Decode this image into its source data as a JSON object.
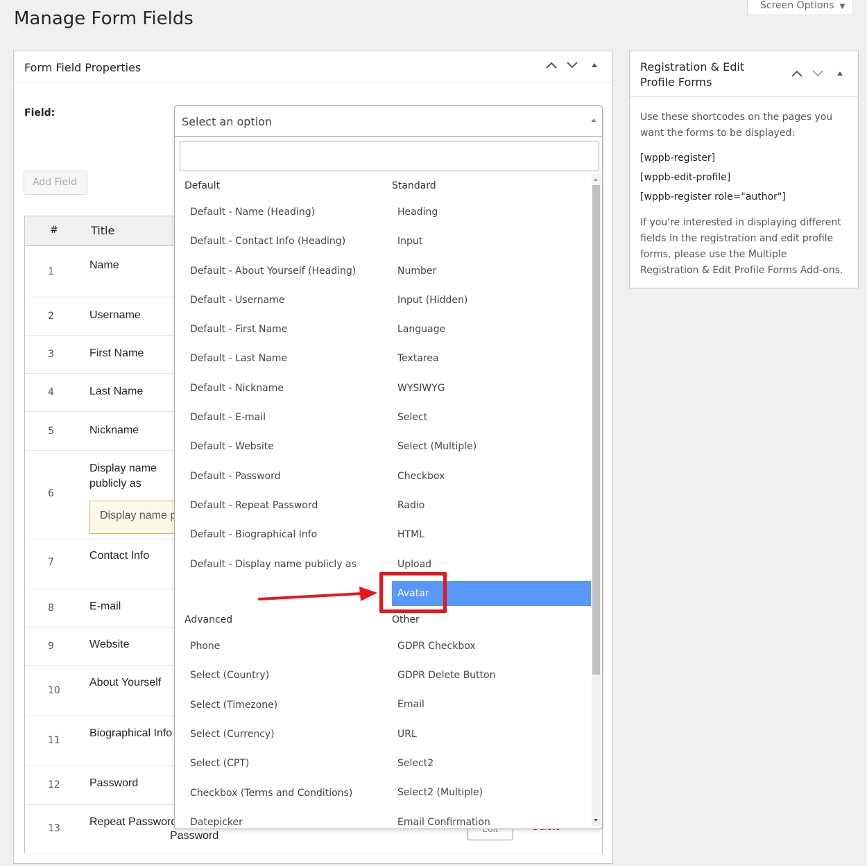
{
  "page": {
    "title": "Manage Form Fields",
    "screen_options": "Screen Options"
  },
  "form_field_box": {
    "title": "Form Field Properties",
    "field_label": "Field:",
    "add_button": "Add Field",
    "table": {
      "headers": {
        "num": "#",
        "title": "Title"
      },
      "rows": [
        {
          "num": "1",
          "title": "Name"
        },
        {
          "num": "2",
          "title": "Username"
        },
        {
          "num": "3",
          "title": "First Name"
        },
        {
          "num": "4",
          "title": "Last Name"
        },
        {
          "num": "5",
          "title": "Nickname"
        },
        {
          "num": "6",
          "title": "Display name publicly as",
          "input_placeholder": "Display name publicly as"
        },
        {
          "num": "7",
          "title": "Contact Info"
        },
        {
          "num": "8",
          "title": "E-mail"
        },
        {
          "num": "9",
          "title": "Website"
        },
        {
          "num": "10",
          "title": "About Yourself"
        },
        {
          "num": "11",
          "title": "Biographical Info"
        },
        {
          "num": "12",
          "title": "Password"
        },
        {
          "num": "13",
          "title": "Repeat Password"
        }
      ],
      "row13_second_line": "Password",
      "edit_label": "Edit",
      "delete_label": "Delete"
    }
  },
  "select": {
    "placeholder": "Select an option",
    "search_value": "",
    "groups": {
      "default": {
        "label": "Default",
        "options": [
          "Default - Name (Heading)",
          "Default - Contact Info (Heading)",
          "Default - About Yourself (Heading)",
          "Default - Username",
          "Default - First Name",
          "Default - Last Name",
          "Default - Nickname",
          "Default - E-mail",
          "Default - Website",
          "Default - Password",
          "Default - Repeat Password",
          "Default - Biographical Info",
          "Default - Display name publicly as"
        ]
      },
      "standard": {
        "label": "Standard",
        "options": [
          "Heading",
          "Input",
          "Number",
          "Input (Hidden)",
          "Language",
          "Textarea",
          "WYSIWYG",
          "Select",
          "Select (Multiple)",
          "Checkbox",
          "Radio",
          "HTML",
          "Upload"
        ],
        "highlighted": "Avatar"
      },
      "advanced": {
        "label": "Advanced",
        "options": [
          "Phone",
          "Select (Country)",
          "Select (Timezone)",
          "Select (Currency)",
          "Select (CPT)",
          "Checkbox (Terms and Conditions)",
          "Datepicker"
        ]
      },
      "other": {
        "label": "Other",
        "options": [
          "GDPR Checkbox",
          "GDPR Delete Button",
          "Email",
          "URL",
          "Select2",
          "Select2 (Multiple)",
          "Email Confirmation"
        ]
      }
    },
    "highlight_color": "#5897fb"
  },
  "shortcodes_box": {
    "title": "Registration & Edit Profile Forms",
    "intro": "Use these shortcodes on the pages you want the forms to be displayed:",
    "shortcodes": [
      "[wppb-register]",
      "[wppb-edit-profile]",
      "[wppb-register role=\"author\"]"
    ],
    "description": "If you're interested in displaying different fields in the registration and edit profile forms, please use the Multiple Registration & Edit Profile Forms Add-ons."
  },
  "annotation": {
    "color": "#e8171b"
  }
}
